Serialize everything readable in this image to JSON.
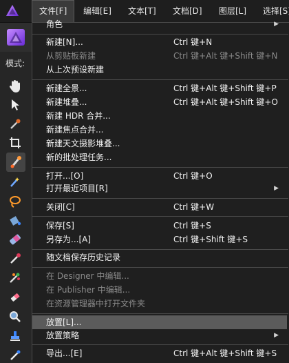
{
  "menubar": {
    "menus": [
      "文件[F]",
      "编辑[E]",
      "文本[T]",
      "文档[D]",
      "图层[L]",
      "选择[S]"
    ]
  },
  "sidebar": {
    "mode_label": "模式:"
  },
  "file_menu": {
    "items": [
      {
        "label": "角色",
        "shortcut": "",
        "submenu": true,
        "enabled": true
      },
      {
        "label": "新建[N]...",
        "shortcut": "Ctrl 键+N",
        "enabled": true
      },
      {
        "label": "从剪贴板新建",
        "shortcut": "Ctrl 键+Alt 键+Shift 键+N",
        "enabled": false
      },
      {
        "label": "从上次预设新建",
        "shortcut": "",
        "enabled": true
      },
      {
        "label": "新建全景...",
        "shortcut": "Ctrl 键+Alt 键+Shift 键+P",
        "enabled": true
      },
      {
        "label": "新建堆叠...",
        "shortcut": "Ctrl 键+Alt 键+Shift 键+O",
        "enabled": true
      },
      {
        "label": "新建 HDR 合并...",
        "shortcut": "",
        "enabled": true
      },
      {
        "label": "新建焦点合并...",
        "shortcut": "",
        "enabled": true
      },
      {
        "label": "新建天文摄影堆叠...",
        "shortcut": "",
        "enabled": true
      },
      {
        "label": "新的批处理任务...",
        "shortcut": "",
        "enabled": true
      },
      {
        "label": "打开...[O]",
        "shortcut": "Ctrl 键+O",
        "enabled": true
      },
      {
        "label": "打开最近项目[R]",
        "shortcut": "",
        "submenu": true,
        "enabled": true
      },
      {
        "label": "关闭[C]",
        "shortcut": "Ctrl 键+W",
        "enabled": true
      },
      {
        "label": "保存[S]",
        "shortcut": "Ctrl 键+S",
        "enabled": true
      },
      {
        "label": "另存为...[A]",
        "shortcut": "Ctrl 键+Shift 键+S",
        "enabled": true
      },
      {
        "label": "随文档保存历史记录",
        "shortcut": "",
        "enabled": true
      },
      {
        "label": "在 Designer 中编辑...",
        "shortcut": "",
        "enabled": false
      },
      {
        "label": "在 Publisher 中编辑...",
        "shortcut": "",
        "enabled": false
      },
      {
        "label": "在资源管理器中打开文件夹",
        "shortcut": "",
        "enabled": false
      },
      {
        "label": "放置[L]...",
        "shortcut": "",
        "enabled": true,
        "highlighted": true
      },
      {
        "label": "放置策略",
        "shortcut": "",
        "submenu": true,
        "enabled": true
      },
      {
        "label": "导出...[E]",
        "shortcut": "Ctrl 键+Alt 键+Shift 键+S",
        "enabled": true
      }
    ]
  },
  "colors": {
    "accent": "#8a4cff",
    "highlight": "#5b5b5b",
    "menu_bg": "#1f1f1f"
  }
}
